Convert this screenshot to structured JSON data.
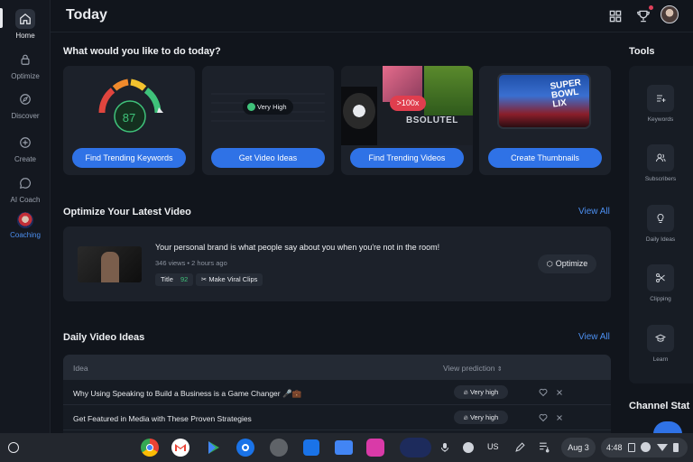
{
  "header": {
    "title": "Today"
  },
  "sidebar": {
    "items": [
      {
        "label": "Home",
        "icon": "home-icon"
      },
      {
        "label": "Optimize",
        "icon": "lock-icon"
      },
      {
        "label": "Discover",
        "icon": "compass-icon"
      },
      {
        "label": "Create",
        "icon": "plus-circle-icon"
      },
      {
        "label": "AI Coach",
        "icon": "chat-icon"
      },
      {
        "label": "Coaching",
        "icon": "coaching-avatar-icon"
      }
    ]
  },
  "actions": {
    "title": "What would you like to do today?",
    "cards": [
      {
        "button": "Find Trending Keywords",
        "score": "87"
      },
      {
        "button": "Get Video Ideas",
        "badge": "Very High"
      },
      {
        "button": "Find Trending Videos",
        "badge": ">100x",
        "overlay": "BSOLUTEL"
      },
      {
        "button": "Create Thumbnails",
        "overlay": "SUPER BOWL LIX"
      }
    ]
  },
  "optimize": {
    "title": "Optimize Your Latest Video",
    "view_all": "View All",
    "video_title": "Your personal brand is what people say about you when you're not in the room!",
    "meta": "346 views • 2 hours ago",
    "title_label": "Title",
    "title_score": "92",
    "clips_label": "Make Viral Clips",
    "button": "Optimize"
  },
  "ideas": {
    "title": "Daily Video Ideas",
    "view_all": "View All",
    "col_idea": "Idea",
    "col_view": "View prediction",
    "rows": [
      {
        "idea": "Why Using Speaking to Build a Business is a Game Changer 🎤💼",
        "prediction": "Very high"
      },
      {
        "idea": "Get Featured in Media with These Proven Strategies",
        "prediction": "Very high"
      }
    ]
  },
  "tools": {
    "title": "Tools",
    "items": [
      "Keywords",
      "Subscribers",
      "Daily Ideas",
      "Clipping",
      "Learn"
    ]
  },
  "channel": {
    "title": "Channel Stat"
  },
  "taskbar": {
    "locale": "US",
    "date": "Aug 3",
    "time": "4:48"
  },
  "colors": {
    "accent": "#2f72e6",
    "link": "#4c8ff0",
    "score_green": "#3fc27a"
  }
}
